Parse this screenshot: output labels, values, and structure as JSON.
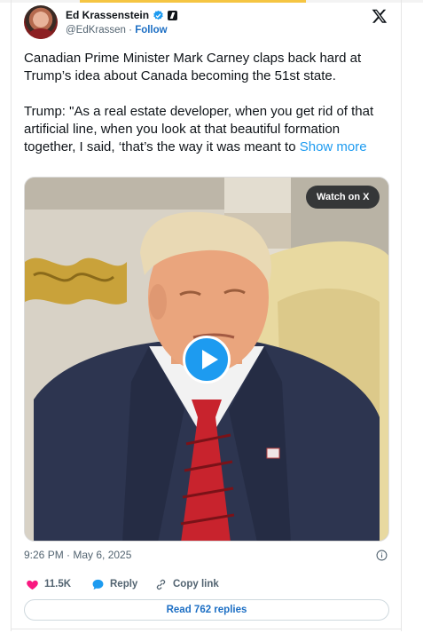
{
  "author": {
    "name": "Ed Krassenstein",
    "handle": "@EdKrassen",
    "follow_label": "Follow",
    "separator": "·"
  },
  "tweet": {
    "paragraph1": "Canadian Prime Minister Mark Carney claps back hard at Trump’s idea about Canada becoming the 51st state.",
    "paragraph2": "Trump: \"As a real estate developer, when you get rid of that artificial line, when you look at that beautiful formation together, I said, ‘that’s the way it was meant to ",
    "show_more_label": "Show more"
  },
  "media": {
    "watch_label": "Watch on X",
    "play_icon": "play-icon"
  },
  "meta": {
    "timestamp": "9:26 PM · May 6, 2025"
  },
  "actions": {
    "likes_count": "11.5K",
    "reply_label": "Reply",
    "copy_link_label": "Copy link"
  },
  "replies_button": {
    "label": "Read 762 replies"
  },
  "colors": {
    "link_blue": "#1d9bf0",
    "follow_blue": "#1d6fc4",
    "heart_pink": "#f91880",
    "text_dark": "#0f1419",
    "text_grey": "#536471"
  }
}
